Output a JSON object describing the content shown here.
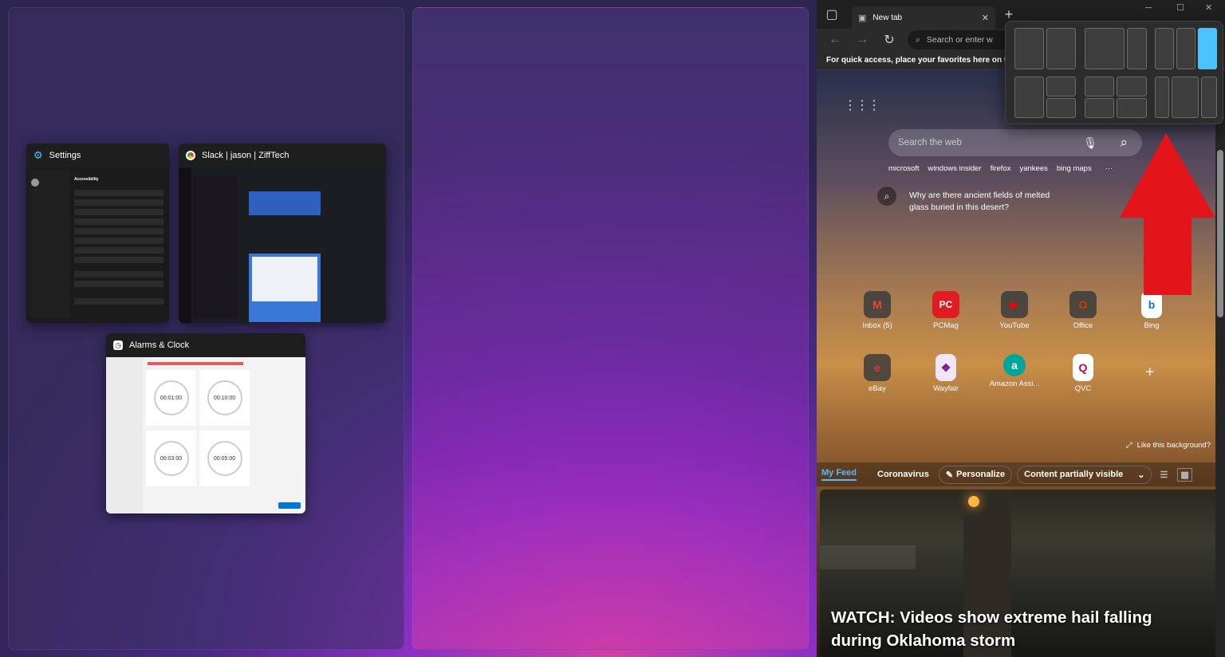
{
  "snap_assist": {
    "windows": [
      {
        "title": "Settings",
        "icon": "gear-icon"
      },
      {
        "title": "Slack | jason | ZiffTech",
        "icon": "chrome-icon"
      },
      {
        "title": "Alarms & Clock",
        "icon": "clock-icon"
      }
    ],
    "settings_thumb": {
      "heading": "Accessibility"
    },
    "alarms_thumb": {
      "timers": [
        "00:01:00",
        "00:10:00",
        "00:03:00",
        "00:05:00"
      ]
    }
  },
  "edge": {
    "tab_title": "New tab",
    "address_placeholder": "Search or enter w",
    "favorites_hint": "For quick access, place your favorites here on the fa",
    "search_placeholder": "Search the web",
    "suggestions": [
      "microsoft",
      "windows insider",
      "firefox",
      "yankees",
      "bing maps"
    ],
    "more_label": "···",
    "question": "Why are there ancient fields of melted glass buried in this desert?",
    "tiles_row1": [
      {
        "label": "Inbox (5)",
        "glyph": "M",
        "color": "#ea4335"
      },
      {
        "label": "PCMag",
        "glyph": "PC",
        "color": "#e11b22"
      },
      {
        "label": "YouTube",
        "glyph": "▶",
        "color": "#ff0000"
      },
      {
        "label": "Office",
        "glyph": "O",
        "color": "#d83b01"
      },
      {
        "label": "Bing",
        "glyph": "b",
        "color": "#0078d4"
      }
    ],
    "tiles_row2": [
      {
        "label": "eBay",
        "glyph": "e",
        "color": "#e53238"
      },
      {
        "label": "Wayfair",
        "glyph": "❖",
        "color": "#7b189f"
      },
      {
        "label": "Amazon Assi...",
        "glyph": "a",
        "color": "#00a699"
      },
      {
        "label": "QVC",
        "glyph": "Q",
        "color": "#b0123a"
      }
    ],
    "add_tile": "+",
    "like_background": "Like this background?",
    "feed_tabs": [
      "My Feed",
      "Coronavirus"
    ],
    "personalize": "Personalize",
    "content_visibility": "Content partially visible",
    "headline": "WATCH: Videos show extreme hail falling during Oklahoma storm"
  },
  "colors": {
    "accent": "#4cc2ff",
    "arrow": "#e3151a"
  }
}
